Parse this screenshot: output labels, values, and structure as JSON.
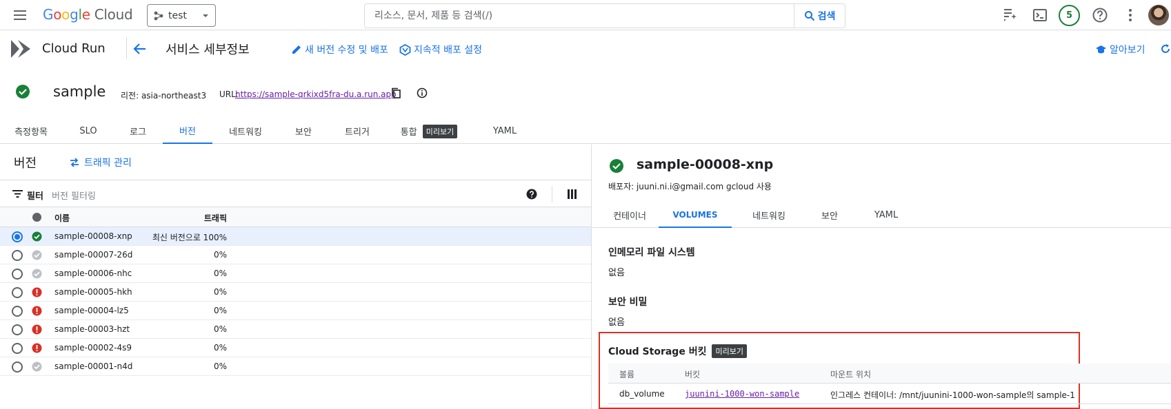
{
  "topbar": {
    "logo_google": [
      "G",
      "o",
      "o",
      "g",
      "l",
      "e"
    ],
    "logo_cloud": "Cloud",
    "project": "test",
    "search_placeholder": "리소스, 문서, 제품 등 검색(/)",
    "search_button": "검색",
    "notification_count": "5"
  },
  "product": {
    "name": "Cloud Run",
    "page_title": "서비스 세부정보",
    "actions": {
      "edit_deploy": "새 버전 수정 및 배포",
      "continuous_deploy": "지속적 배포 설정",
      "learn": "알아보기"
    }
  },
  "service": {
    "name": "sample",
    "region_label": "리전:",
    "region": "asia-northeast3",
    "url_label": "URL:",
    "url": "https://sample-qrkixd5fra-du.a.run.app"
  },
  "tabs": [
    {
      "label": "측정항목"
    },
    {
      "label": "SLO"
    },
    {
      "label": "로그"
    },
    {
      "label": "버전"
    },
    {
      "label": "네트워킹"
    },
    {
      "label": "보안"
    },
    {
      "label": "트리거"
    },
    {
      "label": "통합",
      "badge": "미리보기"
    },
    {
      "label": "YAML"
    }
  ],
  "revisions": {
    "title": "버전",
    "traffic_button": "트래픽 관리",
    "filter_label": "필터",
    "filter_placeholder": "버전 필터링",
    "col_name": "이름",
    "col_traffic": "트래픽",
    "rows": [
      {
        "name": "sample-00008-xnp",
        "traffic": "최신 버전으로 100%",
        "status": "ok"
      },
      {
        "name": "sample-00007-26d",
        "traffic": "0%",
        "status": "inactive"
      },
      {
        "name": "sample-00006-nhc",
        "traffic": "0%",
        "status": "inactive"
      },
      {
        "name": "sample-00005-hkh",
        "traffic": "0%",
        "status": "error"
      },
      {
        "name": "sample-00004-lz5",
        "traffic": "0%",
        "status": "error"
      },
      {
        "name": "sample-00003-hzt",
        "traffic": "0%",
        "status": "error"
      },
      {
        "name": "sample-00002-4s9",
        "traffic": "0%",
        "status": "error"
      },
      {
        "name": "sample-00001-n4d",
        "traffic": "0%",
        "status": "inactive"
      }
    ]
  },
  "detail": {
    "title": "sample-00008-xnp",
    "deployer": "배포자: juuni.ni.i@gmail.com gcloud 사용",
    "tabs": [
      {
        "label": "컨테이너"
      },
      {
        "label": "VOLUMES"
      },
      {
        "label": "네트워킹"
      },
      {
        "label": "보안"
      },
      {
        "label": "YAML"
      }
    ],
    "inmemory_title": "인메모리 파일 시스템",
    "inmemory_value": "없음",
    "secret_title": "보안 비밀",
    "secret_value": "없음",
    "gcs_title": "Cloud Storage 버킷",
    "gcs_badge": "미리보기",
    "gcs_cols": {
      "volume": "볼륨",
      "bucket": "버킷",
      "mount": "마운트 위치"
    },
    "gcs_row": {
      "volume": "db_volume",
      "bucket": "juunini-1000-won-sample",
      "mount": "인그레스 컨테이너: /mnt/juunini-1000-won-sample의 sample-1"
    }
  },
  "colors": {
    "accent": "#1a73e8",
    "ok": "#188038",
    "error": "#d93025",
    "inactive": "#bdc1c6",
    "highlight_box": "#d93025"
  }
}
